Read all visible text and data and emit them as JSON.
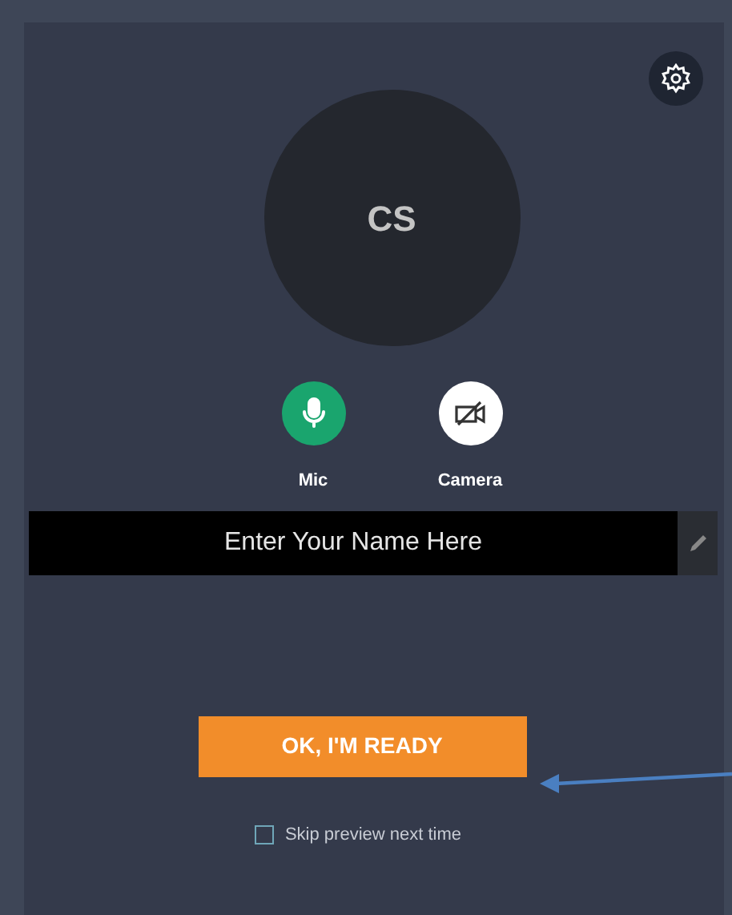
{
  "avatar": {
    "initials": "CS"
  },
  "media_controls": [
    {
      "kind": "mic",
      "label": "Mic",
      "on": true
    },
    {
      "kind": "camera",
      "label": "Camera",
      "on": false
    }
  ],
  "name_field": {
    "placeholder": "Enter Your Name Here"
  },
  "ready_button": {
    "label": "OK, I'M READY"
  },
  "skip_preview": {
    "label": "Skip preview next time",
    "checked": false
  }
}
